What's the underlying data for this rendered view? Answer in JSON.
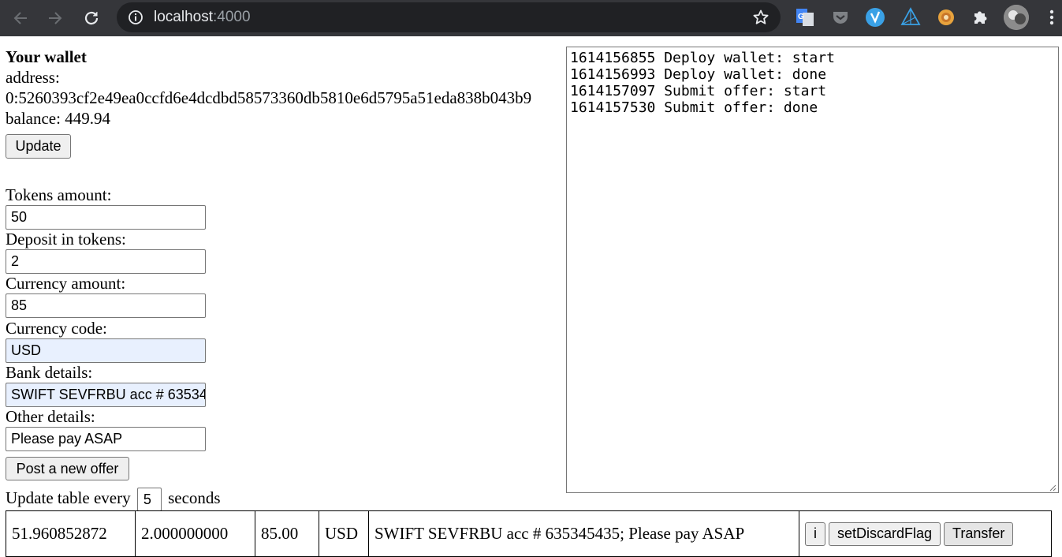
{
  "browser": {
    "url_host": "localhost",
    "url_port": ":4000",
    "extensions": [
      "translate-icon",
      "pocket-icon",
      "vivaldi-icon",
      "triangle-icon",
      "gear-flower-icon",
      "puzzle-icon",
      "avatar",
      "menu-icon"
    ]
  },
  "wallet": {
    "heading": "Your wallet",
    "address_label": "address:",
    "address": "0:5260393cf2e49ea0ccfd6e4dcdbd58573360db5810e6d5795a51eda838b043b9",
    "balance": "balance: 449.94",
    "update_label": "Update"
  },
  "form": {
    "tokens_label": "Tokens amount:",
    "tokens_value": "50",
    "deposit_label": "Deposit in tokens:",
    "deposit_value": "2",
    "currency_amount_label": "Currency amount:",
    "currency_amount_value": "85",
    "currency_code_label": "Currency code:",
    "currency_code_value": "USD",
    "bank_label": "Bank details:",
    "bank_value": "SWIFT SEVFRBU acc # 635345435",
    "other_label": "Other details:",
    "other_value": "Please pay ASAP",
    "post_label": "Post a new offer"
  },
  "refresh": {
    "prefix": "Update table every",
    "value": "5",
    "suffix": "seconds"
  },
  "log": "1614156855 Deploy wallet: start\n1614156993 Deploy wallet: done\n1614157097 Submit offer: start\n1614157530 Submit offer: done",
  "offers": [
    {
      "tokens": "51.960852872",
      "deposit": "2.000000000",
      "amount": "85.00",
      "currency": "USD",
      "details": "SWIFT SEVFRBU acc # 635345435; Please pay ASAP",
      "info_label": "i",
      "discard_label": "setDiscardFlag",
      "transfer_label": "Transfer"
    }
  ]
}
